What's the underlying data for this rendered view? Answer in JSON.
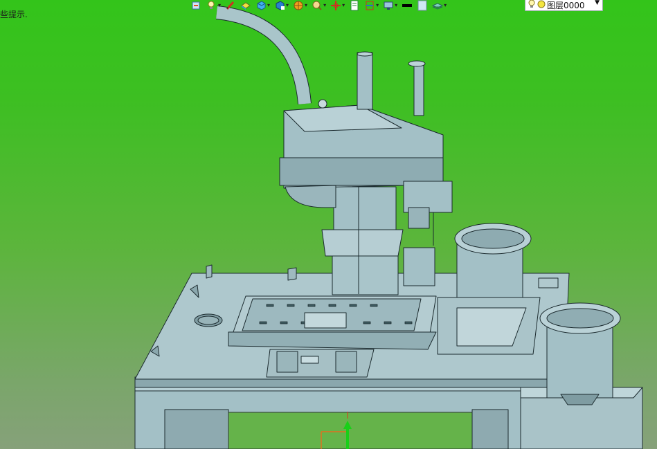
{
  "status": {
    "hint": "些提示."
  },
  "toolbar": {
    "buttons": [
      {
        "icon": "import-icon",
        "dropdown": false
      },
      {
        "icon": "light-bulb-icon",
        "dropdown": true
      },
      {
        "icon": "pen-icon",
        "dropdown": false
      },
      {
        "icon": "face-color-icon",
        "dropdown": false
      },
      {
        "icon": "view-cube-icon",
        "dropdown": true
      },
      {
        "icon": "standard-views-icon",
        "dropdown": true
      },
      {
        "icon": "render-mode-icon",
        "dropdown": true
      },
      {
        "icon": "zoom-icon",
        "dropdown": true
      },
      {
        "icon": "pan-icon",
        "dropdown": true
      },
      {
        "icon": "new-sheet-icon",
        "dropdown": false
      },
      {
        "icon": "section-icon",
        "dropdown": true
      },
      {
        "icon": "monitor-icon",
        "dropdown": true
      },
      {
        "icon": "line-weight-icon",
        "dropdown": false
      },
      {
        "icon": "blank-color-icon",
        "dropdown": false
      },
      {
        "icon": "layer-stack-icon",
        "dropdown": true
      }
    ],
    "layer_combo": {
      "value": "图层0000"
    }
  },
  "colors": {
    "background_top": "#33c41a",
    "background_bottom": "#86a17a",
    "machine_fill": "#a3c0c6",
    "machine_dark": "#6f8f96",
    "edge": "#1b2a2e",
    "triad_green": "#18d018",
    "triad_red": "#e03020"
  }
}
